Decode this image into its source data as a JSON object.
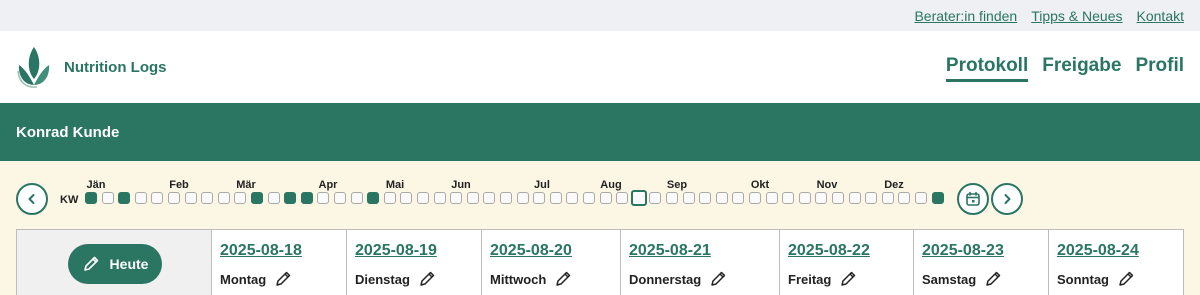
{
  "top_links": [
    "Berater:in finden",
    "Tipps & Neues",
    "Kontakt"
  ],
  "brand": "Nutrition Logs",
  "nav": [
    {
      "label": "Protokoll",
      "active": true
    },
    {
      "label": "Freigabe",
      "active": false
    },
    {
      "label": "Profil",
      "active": false
    }
  ],
  "user": {
    "name": "Konrad Kunde"
  },
  "week_strip": {
    "kw_label": "KW",
    "months": [
      "Jän",
      "Feb",
      "Mär",
      "Apr",
      "Mai",
      "Jun",
      "Jul",
      "Aug",
      "Sep",
      "Okt",
      "Nov",
      "Dez"
    ],
    "week_count": 52,
    "filled_weeks": [
      1,
      3,
      11,
      13,
      14,
      18,
      52
    ],
    "current_week": 34
  },
  "today_button": "Heute",
  "days": [
    {
      "date": "2025-08-18",
      "weekday": "Montag"
    },
    {
      "date": "2025-08-19",
      "weekday": "Dienstag"
    },
    {
      "date": "2025-08-20",
      "weekday": "Mittwoch"
    },
    {
      "date": "2025-08-21",
      "weekday": "Donnerstag"
    },
    {
      "date": "2025-08-22",
      "weekday": "Freitag"
    },
    {
      "date": "2025-08-23",
      "weekday": "Samstag"
    },
    {
      "date": "2025-08-24",
      "weekday": "Sonntag"
    }
  ],
  "colors": {
    "brand_green": "#2b7563",
    "cream": "#fbf7e4",
    "top_bar": "#eef0f3"
  }
}
